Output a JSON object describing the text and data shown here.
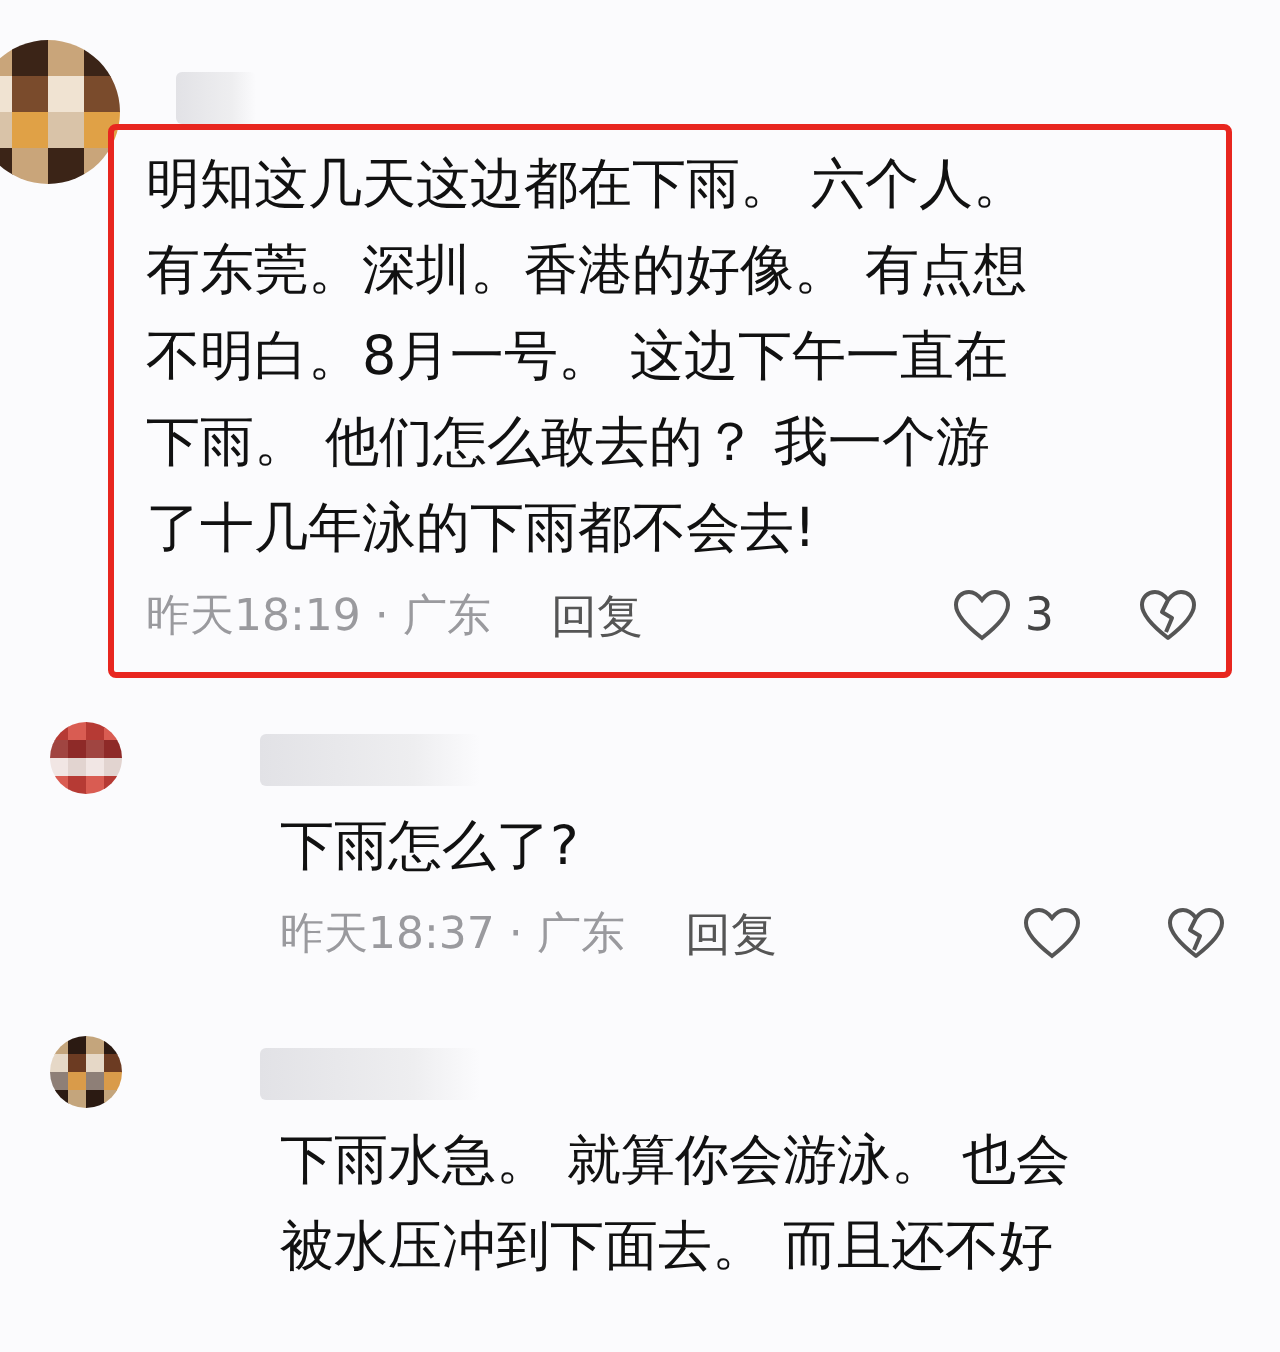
{
  "comments": [
    {
      "highlighted": true,
      "lines": [
        "明知这几天这边都在下雨。 六个人。",
        "有东莞。深圳。香港的好像。 有点想",
        "不明白。8月一号。 这边下午一直在",
        "下雨。 他们怎么敢去的？  我一个游",
        "了十几年泳的下雨都不会去!"
      ],
      "time": "昨天18:19",
      "separator": "·",
      "location": "广东",
      "reply": "回复",
      "likes": "3"
    },
    {
      "highlighted": false,
      "lines": [
        "下雨怎么了?"
      ],
      "time": "昨天18:37",
      "separator": "·",
      "location": "广东",
      "reply": "回复"
    },
    {
      "highlighted": false,
      "lines": [
        "下雨水急。 就算你会游泳。 也会",
        "被水压冲到下面去。 而且还不好"
      ]
    }
  ]
}
